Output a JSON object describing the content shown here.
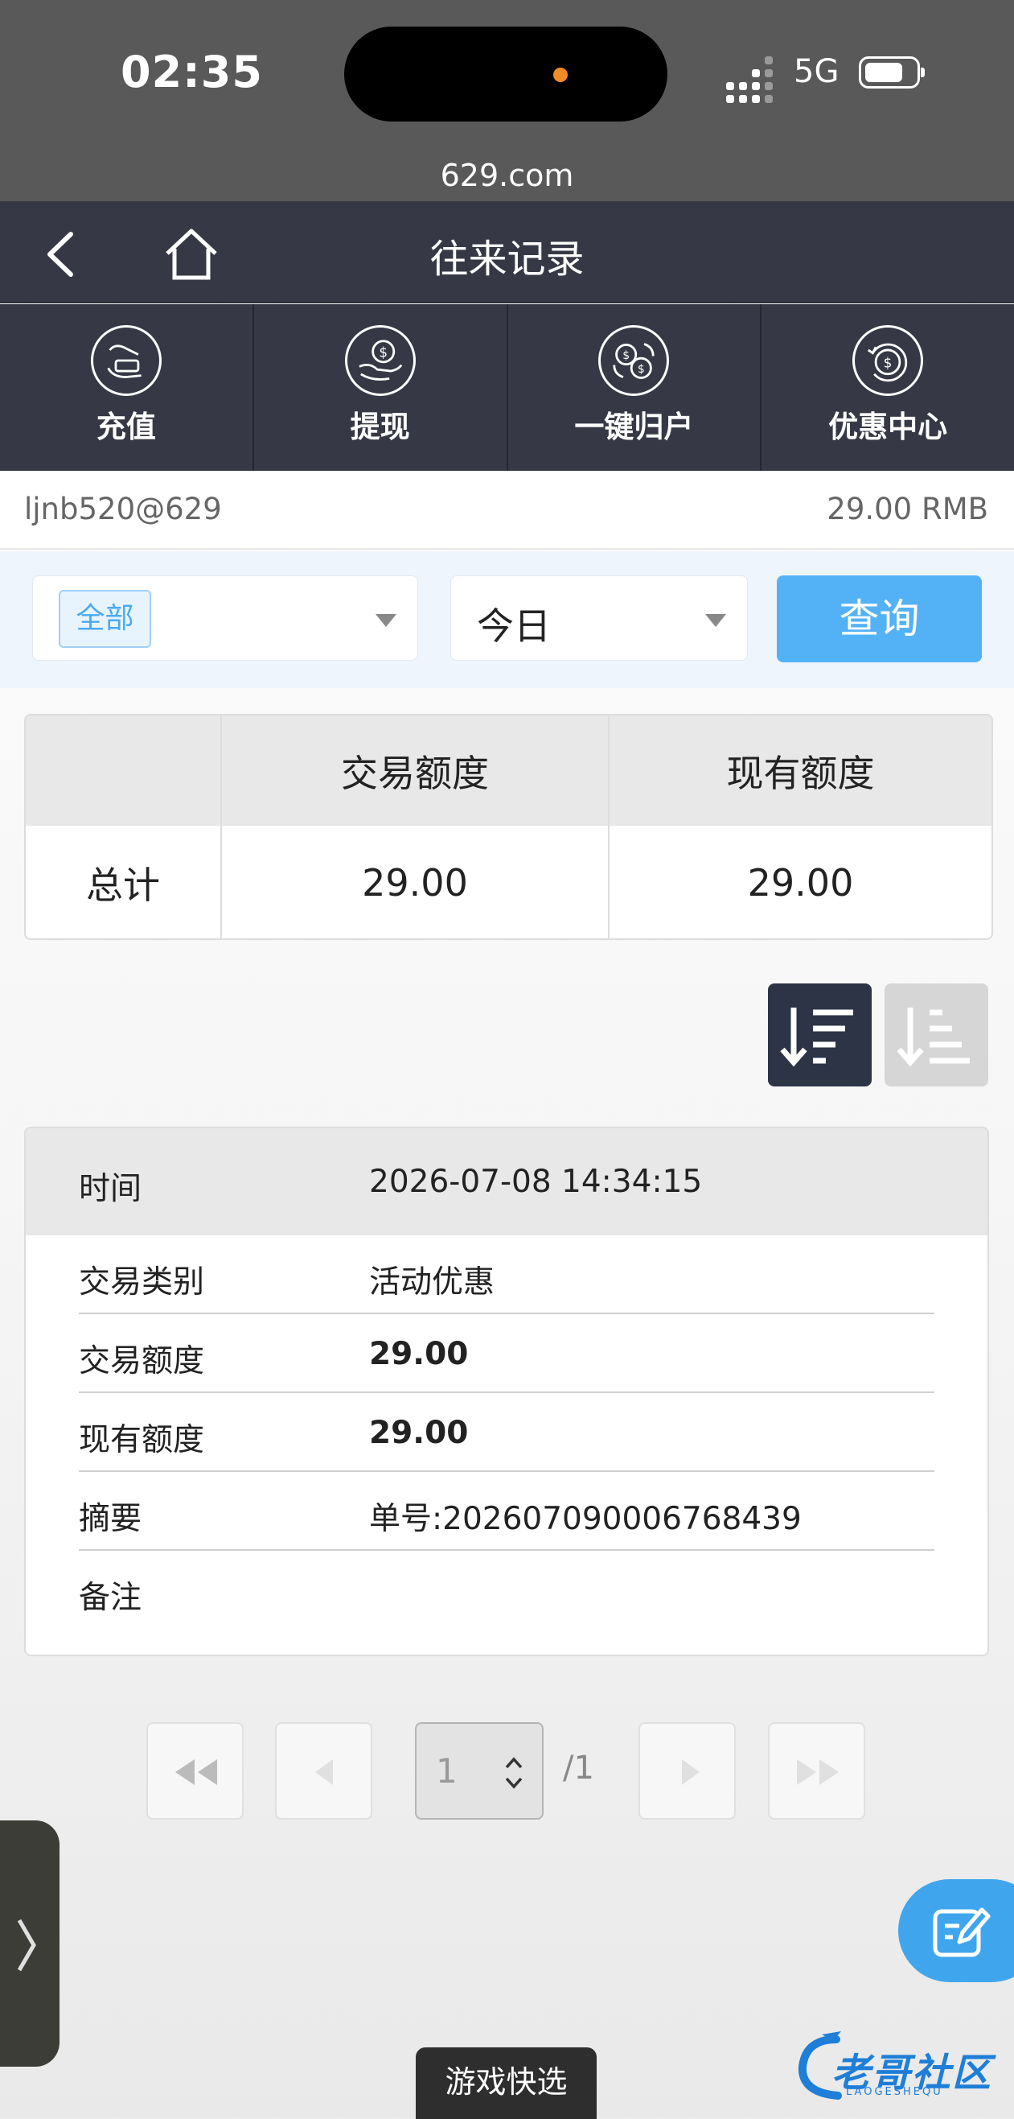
{
  "status_bar": {
    "time": "02:35",
    "network": "5G",
    "url": "629.com"
  },
  "header": {
    "title": "往来记录"
  },
  "quick_nav": [
    {
      "label": "充值",
      "icon": "deposit-icon"
    },
    {
      "label": "提现",
      "icon": "withdraw-icon"
    },
    {
      "label": "一键归户",
      "icon": "transfer-icon"
    },
    {
      "label": "优惠中心",
      "icon": "promo-icon"
    }
  ],
  "account": {
    "username": "ljnb520@629",
    "balance": "29.00 RMB"
  },
  "filter": {
    "type_selected": "全部",
    "date_selected": "今日",
    "query_label": "查询"
  },
  "totals": {
    "headers": [
      "",
      "交易额度",
      "现有额度"
    ],
    "row_label": "总计",
    "trade_amount": "29.00",
    "current_amount": "29.00"
  },
  "record": {
    "time_label": "时间",
    "time_value": "2026-07-08 14:34:15",
    "rows": [
      {
        "label": "交易类别",
        "value": "活动优惠"
      },
      {
        "label": "交易额度",
        "value": "29.00"
      },
      {
        "label": "现有额度",
        "value": "29.00"
      },
      {
        "label": "摘要",
        "value": "单号:202607090006768439"
      },
      {
        "label": "备注",
        "value": ""
      }
    ]
  },
  "pagination": {
    "current_page": "1",
    "total": "/1"
  },
  "bottom": {
    "quick_game_label": "游戏快选",
    "watermark_text": "老哥社区",
    "watermark_sub": "LAOGESHEQU"
  },
  "colors": {
    "header_bg": "#363945",
    "accent": "#53b2f5",
    "status_bar": "#595959"
  }
}
